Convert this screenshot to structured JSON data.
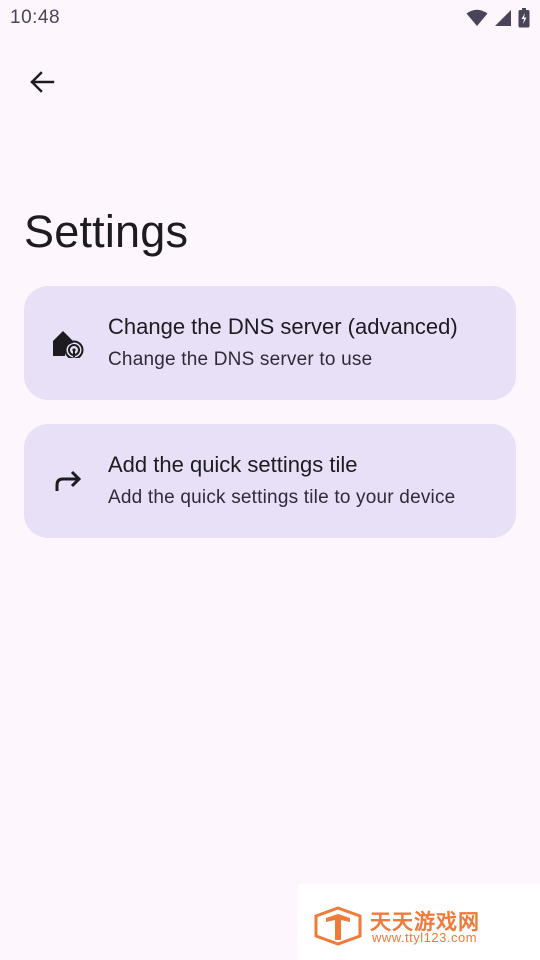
{
  "status_bar": {
    "time": "10:48",
    "icons": [
      "wifi-icon",
      "signal-icon",
      "battery-charging-icon"
    ]
  },
  "toolbar": {
    "back_icon": "arrow-back-icon"
  },
  "page": {
    "title": "Settings"
  },
  "settings": {
    "items": [
      {
        "icon": "home-dns-icon",
        "title": "Change the DNS server (advanced)",
        "subtitle": "Change the DNS server to use"
      },
      {
        "icon": "redo-arrow-icon",
        "title": "Add the quick settings tile",
        "subtitle": "Add the quick settings tile to your device"
      }
    ]
  },
  "watermark": {
    "name": "天天游戏网",
    "url": "www.ttyl123.com"
  },
  "colors": {
    "background": "#fdf7fd",
    "card": "#e8e0f6",
    "text": "#1d1b20",
    "watermark": "#f07a3a"
  }
}
